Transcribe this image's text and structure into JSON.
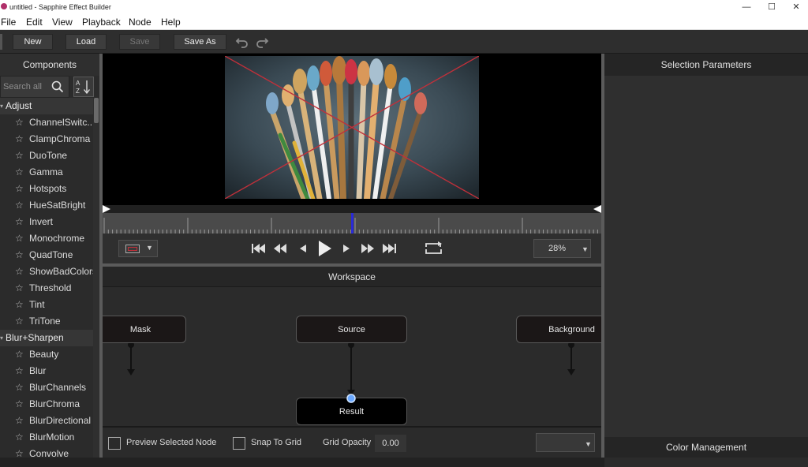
{
  "window": {
    "title": "untitled - Sapphire Effect Builder",
    "minimize_glyph": "—",
    "maximize_glyph": "☐",
    "close_glyph": "✕"
  },
  "menu": {
    "file": "File",
    "edit": "Edit",
    "view": "View",
    "playback": "Playback",
    "node": "Node",
    "help": "Help"
  },
  "toolbar": {
    "new_label": "New",
    "load_label": "Load",
    "save_label": "Save",
    "save_as_label": "Save As",
    "save_enabled": false,
    "icons": [
      "undo-icon",
      "redo-icon"
    ]
  },
  "components": {
    "header": "Components",
    "search_placeholder": "Search all",
    "categories": [
      {
        "name": "Adjust",
        "items": [
          "ChannelSwitc...",
          "ClampChroma",
          "DuoTone",
          "Gamma",
          "Hotspots",
          "HueSatBright",
          "Invert",
          "Monochrome",
          "QuadTone",
          "ShowBadColors",
          "Threshold",
          "Tint",
          "TriTone"
        ]
      },
      {
        "name": "Blur+Sharpen",
        "items": [
          "Beauty",
          "Blur",
          "BlurChannels",
          "BlurChroma",
          "BlurDirectional",
          "BlurMotion",
          "Convolve"
        ]
      }
    ]
  },
  "viewer": {
    "playhead_fraction": 0.5,
    "zoom": "28%",
    "transport_icons": [
      "skip-to-start-icon",
      "step-back-icon",
      "prev-frame-icon",
      "play-icon",
      "next-frame-icon",
      "step-forward-icon",
      "skip-to-end-icon",
      "loop-icon"
    ]
  },
  "workspace": {
    "header": "Workspace",
    "nodes": {
      "mask": "Mask",
      "source": "Source",
      "background": "Background",
      "result": "Result"
    },
    "footer": {
      "preview_label": "Preview Selected Node",
      "preview_checked": false,
      "snap_label": "Snap To Grid",
      "snap_checked": false,
      "grid_opacity_label": "Grid Opacity",
      "grid_opacity_value": "0.00"
    }
  },
  "right_panel": {
    "header": "Selection Parameters",
    "footer": "Color Management"
  },
  "colors": {
    "playhead": "#2a2ad8",
    "accent_node_port": "#6aa8ff",
    "app_icon": "#b0306a"
  }
}
